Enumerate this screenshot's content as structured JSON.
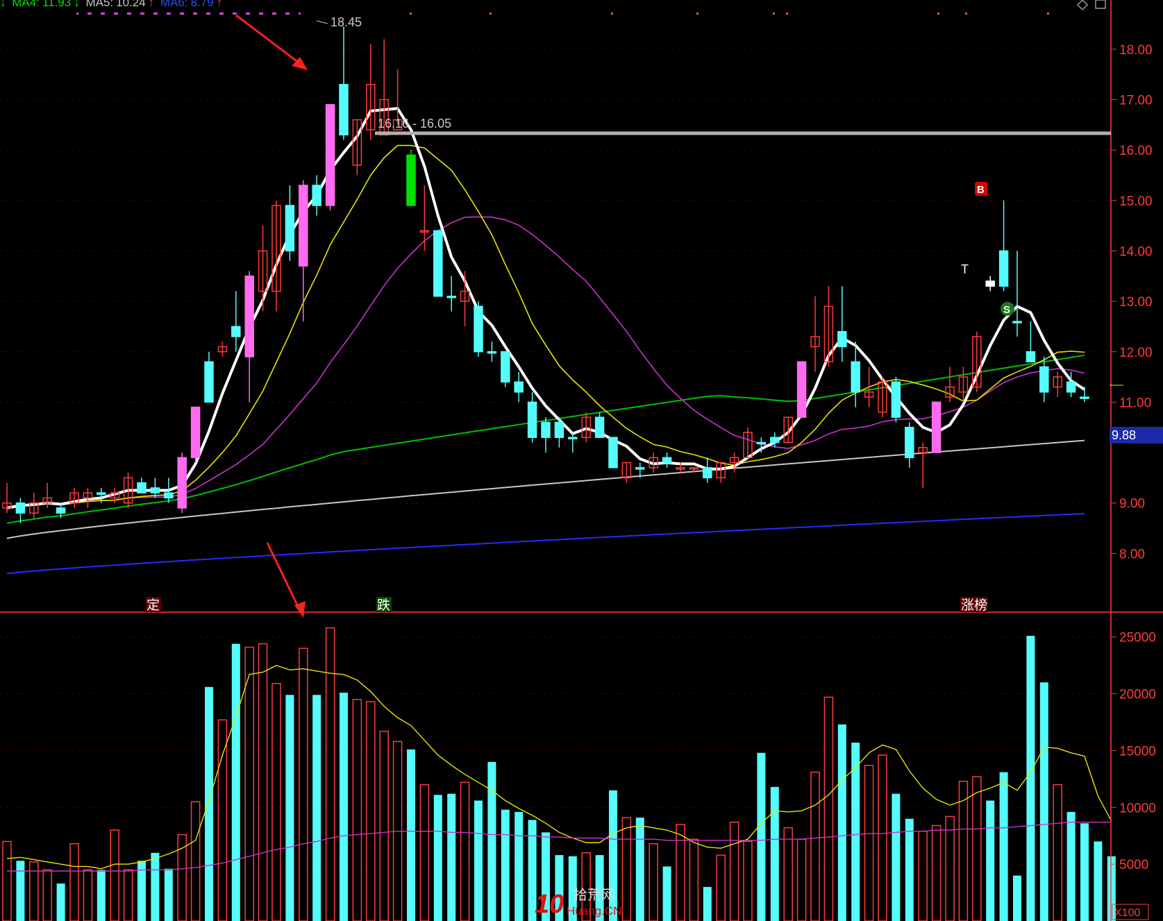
{
  "header": {
    "ma_items": [
      {
        "label": "MA4:",
        "value": "11.93",
        "arrow": "↓",
        "color": "#00e000"
      },
      {
        "label": "MA5:",
        "value": "10.24",
        "arrow": "↑",
        "color": "#c8c8c8"
      },
      {
        "label": "MA6:",
        "value": "8.79",
        "arrow": "↑",
        "color": "#2a4cff"
      }
    ]
  },
  "annotations": {
    "peak_label": "18.45",
    "level_label": "16.16 - 16.05",
    "current_price": "9.88",
    "signal_b": "B",
    "signal_s": "S",
    "signal_t": "T",
    "event_1": "定",
    "event_2": "跌",
    "event_3": "涨榜",
    "volume_unit": "X100",
    "watermark_cn": "拾荒网",
    "watermark_en": "Huang.CN",
    "watermark_num": "10"
  },
  "colors": {
    "up": "#ff3c3c",
    "down": "#54fcfc",
    "big_up": "#ff6bf0",
    "big_down": "#00e000",
    "ma1": "#ffffff",
    "ma2": "#e6e600",
    "ma3": "#cc33cc",
    "ma4": "#00c000",
    "ma5": "#c8c8c8",
    "ma6": "#2a2aff",
    "axis": "#ff3c3c"
  },
  "chart_data": [
    {
      "type": "candlestick",
      "y_ticks": [
        "18.00",
        "17.00",
        "16.00",
        "15.00",
        "14.00",
        "13.00",
        "12.00",
        "11.00",
        "9.00",
        "8.00"
      ],
      "ylim": [
        7.0,
        18.7
      ],
      "candles": [
        {
          "o": 9.0,
          "h": 9.4,
          "l": 8.8,
          "c": 8.9,
          "t": "up"
        },
        {
          "o": 8.8,
          "h": 9.1,
          "l": 8.6,
          "c": 9.0,
          "t": "down"
        },
        {
          "o": 8.8,
          "h": 9.2,
          "l": 8.7,
          "c": 9.0,
          "t": "up"
        },
        {
          "o": 9.0,
          "h": 9.4,
          "l": 8.9,
          "c": 9.1,
          "t": "up"
        },
        {
          "o": 8.9,
          "h": 9.0,
          "l": 8.7,
          "c": 8.8,
          "t": "down"
        },
        {
          "o": 9.0,
          "h": 9.3,
          "l": 8.9,
          "c": 9.2,
          "t": "up"
        },
        {
          "o": 9.1,
          "h": 9.3,
          "l": 8.9,
          "c": 9.2,
          "t": "up"
        },
        {
          "o": 9.2,
          "h": 9.3,
          "l": 9.0,
          "c": 9.2,
          "t": "down"
        },
        {
          "o": 9.2,
          "h": 9.3,
          "l": 9.0,
          "c": 9.1,
          "t": "up"
        },
        {
          "o": 9.0,
          "h": 9.6,
          "l": 8.9,
          "c": 9.5,
          "t": "up"
        },
        {
          "o": 9.4,
          "h": 9.5,
          "l": 9.2,
          "c": 9.2,
          "t": "down"
        },
        {
          "o": 9.3,
          "h": 9.5,
          "l": 9.1,
          "c": 9.2,
          "t": "down"
        },
        {
          "o": 9.2,
          "h": 9.5,
          "l": 9.0,
          "c": 9.1,
          "t": "down"
        },
        {
          "o": 8.9,
          "h": 10.0,
          "l": 8.8,
          "c": 9.9,
          "t": "bigup"
        },
        {
          "o": 9.9,
          "h": 10.9,
          "l": 9.8,
          "c": 10.9,
          "t": "bigup"
        },
        {
          "o": 11.0,
          "h": 12.0,
          "l": 11.0,
          "c": 11.8,
          "t": "down"
        },
        {
          "o": 12.0,
          "h": 12.2,
          "l": 11.9,
          "c": 12.1,
          "t": "up"
        },
        {
          "o": 12.3,
          "h": 13.2,
          "l": 12.0,
          "c": 12.5,
          "t": "down"
        },
        {
          "o": 11.9,
          "h": 13.6,
          "l": 11.0,
          "c": 13.5,
          "t": "bigup"
        },
        {
          "o": 13.2,
          "h": 14.5,
          "l": 12.8,
          "c": 14.0,
          "t": "up"
        },
        {
          "o": 13.2,
          "h": 15.0,
          "l": 12.8,
          "c": 14.9,
          "t": "up"
        },
        {
          "o": 14.0,
          "h": 15.3,
          "l": 13.8,
          "c": 14.9,
          "t": "down"
        },
        {
          "o": 13.7,
          "h": 15.4,
          "l": 12.6,
          "c": 15.3,
          "t": "bigup"
        },
        {
          "o": 14.9,
          "h": 15.5,
          "l": 14.7,
          "c": 15.3,
          "t": "down"
        },
        {
          "o": 14.9,
          "h": 16.9,
          "l": 14.8,
          "c": 16.9,
          "t": "bigup"
        },
        {
          "o": 17.3,
          "h": 18.45,
          "l": 16.2,
          "c": 16.3,
          "t": "down"
        },
        {
          "o": 15.7,
          "h": 16.6,
          "l": 15.5,
          "c": 16.6,
          "t": "up"
        },
        {
          "o": 16.4,
          "h": 18.1,
          "l": 16.2,
          "c": 17.3,
          "t": "up"
        },
        {
          "o": 16.3,
          "h": 18.2,
          "l": 16.3,
          "c": 17.0,
          "t": "up"
        },
        {
          "o": 16.6,
          "h": 17.6,
          "l": 16.5,
          "c": 16.4,
          "t": "up"
        },
        {
          "o": 15.9,
          "h": 16.0,
          "l": 14.9,
          "c": 14.9,
          "t": "bigdown"
        },
        {
          "o": 14.4,
          "h": 15.3,
          "l": 14.0,
          "c": 14.4,
          "t": "up"
        },
        {
          "o": 14.4,
          "h": 14.4,
          "l": 13.1,
          "c": 13.1,
          "t": "down"
        },
        {
          "o": 13.1,
          "h": 13.5,
          "l": 12.8,
          "c": 13.1,
          "t": "down"
        },
        {
          "o": 13.2,
          "h": 13.6,
          "l": 12.5,
          "c": 13.0,
          "t": "up"
        },
        {
          "o": 12.9,
          "h": 13.0,
          "l": 11.9,
          "c": 12.0,
          "t": "down"
        },
        {
          "o": 12.0,
          "h": 12.2,
          "l": 11.8,
          "c": 12.0,
          "t": "down"
        },
        {
          "o": 12.0,
          "h": 12.0,
          "l": 11.3,
          "c": 11.4,
          "t": "down"
        },
        {
          "o": 11.2,
          "h": 11.6,
          "l": 11.0,
          "c": 11.4,
          "t": "down"
        },
        {
          "o": 11.0,
          "h": 11.2,
          "l": 10.2,
          "c": 10.3,
          "t": "down"
        },
        {
          "o": 10.3,
          "h": 10.7,
          "l": 10.0,
          "c": 10.6,
          "t": "down"
        },
        {
          "o": 10.6,
          "h": 10.7,
          "l": 10.1,
          "c": 10.3,
          "t": "down"
        },
        {
          "o": 10.3,
          "h": 10.4,
          "l": 10.0,
          "c": 10.3,
          "t": "down"
        },
        {
          "o": 10.3,
          "h": 10.8,
          "l": 10.2,
          "c": 10.7,
          "t": "up"
        },
        {
          "o": 10.7,
          "h": 10.8,
          "l": 10.3,
          "c": 10.3,
          "t": "down"
        },
        {
          "o": 10.3,
          "h": 10.3,
          "l": 9.7,
          "c": 9.7,
          "t": "down"
        },
        {
          "o": 9.5,
          "h": 9.8,
          "l": 9.4,
          "c": 9.8,
          "t": "up"
        },
        {
          "o": 9.7,
          "h": 9.8,
          "l": 9.5,
          "c": 9.7,
          "t": "down"
        },
        {
          "o": 9.7,
          "h": 10.0,
          "l": 9.6,
          "c": 9.9,
          "t": "up"
        },
        {
          "o": 9.9,
          "h": 10.0,
          "l": 9.7,
          "c": 9.8,
          "t": "down"
        },
        {
          "o": 9.7,
          "h": 9.8,
          "l": 9.6,
          "c": 9.7,
          "t": "up"
        },
        {
          "o": 9.7,
          "h": 9.7,
          "l": 9.6,
          "c": 9.7,
          "t": "up"
        },
        {
          "o": 9.7,
          "h": 9.9,
          "l": 9.4,
          "c": 9.5,
          "t": "down"
        },
        {
          "o": 9.5,
          "h": 9.8,
          "l": 9.4,
          "c": 9.8,
          "t": "up"
        },
        {
          "o": 9.8,
          "h": 10.0,
          "l": 9.6,
          "c": 9.9,
          "t": "up"
        },
        {
          "o": 9.9,
          "h": 10.5,
          "l": 9.9,
          "c": 10.4,
          "t": "up"
        },
        {
          "o": 10.2,
          "h": 10.3,
          "l": 10.0,
          "c": 10.2,
          "t": "down"
        },
        {
          "o": 10.2,
          "h": 10.4,
          "l": 10.1,
          "c": 10.3,
          "t": "down"
        },
        {
          "o": 10.2,
          "h": 10.7,
          "l": 10.2,
          "c": 10.7,
          "t": "up"
        },
        {
          "o": 10.7,
          "h": 11.8,
          "l": 10.7,
          "c": 11.8,
          "t": "bigup"
        },
        {
          "o": 12.1,
          "h": 13.1,
          "l": 11.6,
          "c": 12.3,
          "t": "up"
        },
        {
          "o": 11.8,
          "h": 13.3,
          "l": 11.7,
          "c": 12.9,
          "t": "up"
        },
        {
          "o": 12.4,
          "h": 13.3,
          "l": 11.8,
          "c": 12.1,
          "t": "down"
        },
        {
          "o": 11.8,
          "h": 12.2,
          "l": 10.9,
          "c": 11.2,
          "t": "down"
        },
        {
          "o": 11.2,
          "h": 11.7,
          "l": 10.9,
          "c": 11.1,
          "t": "up"
        },
        {
          "o": 10.8,
          "h": 11.5,
          "l": 10.7,
          "c": 11.4,
          "t": "up"
        },
        {
          "o": 11.4,
          "h": 11.5,
          "l": 10.6,
          "c": 10.7,
          "t": "down"
        },
        {
          "o": 10.5,
          "h": 10.6,
          "l": 9.7,
          "c": 9.9,
          "t": "down"
        },
        {
          "o": 10.1,
          "h": 10.2,
          "l": 9.3,
          "c": 10.0,
          "t": "up"
        },
        {
          "o": 10.0,
          "h": 11.0,
          "l": 10.0,
          "c": 11.0,
          "t": "bigup"
        },
        {
          "o": 11.1,
          "h": 11.7,
          "l": 11.0,
          "c": 11.3,
          "t": "up"
        },
        {
          "o": 11.2,
          "h": 11.7,
          "l": 11.0,
          "c": 11.5,
          "t": "up"
        },
        {
          "o": 11.3,
          "h": 12.4,
          "l": 11.2,
          "c": 12.3,
          "t": "up"
        },
        {
          "o": 13.3,
          "h": 13.5,
          "l": 13.2,
          "c": 13.4,
          "t": "T"
        },
        {
          "o": 14.0,
          "h": 15.0,
          "l": 13.2,
          "c": 13.3,
          "t": "down"
        },
        {
          "o": 12.6,
          "h": 14.0,
          "l": 12.3,
          "c": 12.6,
          "t": "down"
        },
        {
          "o": 12.0,
          "h": 12.6,
          "l": 11.8,
          "c": 11.8,
          "t": "down"
        },
        {
          "o": 11.7,
          "h": 11.9,
          "l": 11.0,
          "c": 11.2,
          "t": "down"
        },
        {
          "o": 11.3,
          "h": 11.6,
          "l": 11.1,
          "c": 11.5,
          "t": "up"
        },
        {
          "o": 11.4,
          "h": 11.6,
          "l": 11.1,
          "c": 11.2,
          "t": "down"
        },
        {
          "o": 11.1,
          "h": 11.3,
          "l": 11.0,
          "c": 11.1,
          "t": "down"
        }
      ]
    },
    {
      "type": "bar",
      "y_ticks": [
        "25000",
        "20000",
        "15000",
        "10000",
        "5000"
      ],
      "ylim": [
        0,
        27000
      ],
      "values": [
        7000,
        5300,
        5200,
        4500,
        3300,
        6800,
        4500,
        4500,
        8000,
        4500,
        5300,
        6000,
        4600,
        7600,
        10500,
        20600,
        17700,
        24400,
        24100,
        24400,
        20900,
        19900,
        24000,
        19900,
        25800,
        20100,
        19500,
        19300,
        16700,
        15800,
        15100,
        12000,
        11100,
        11200,
        12200,
        10600,
        14000,
        9800,
        9600,
        8900,
        7800,
        5800,
        5700,
        6000,
        5800,
        11500,
        9100,
        9100,
        6800,
        4800,
        8500,
        7200,
        3000,
        5800,
        8700,
        7000,
        14800,
        11800,
        8200,
        7200,
        13100,
        19700,
        17300,
        15700,
        13700,
        14600,
        11200,
        9000,
        7900,
        8400,
        9200,
        12300,
        12700,
        10600,
        13100,
        4000,
        25100,
        21000,
        12000,
        9600,
        8600,
        7000,
        5700
      ],
      "series": [
        {
          "name": "MA1",
          "color": "#e6e600",
          "values": [
            5500,
            5600,
            5400,
            5200,
            5000,
            4800,
            4800,
            4600,
            5000,
            5000,
            5200,
            5500,
            5900,
            6400,
            7100,
            10600,
            14600,
            18000,
            21700,
            21900,
            22500,
            22100,
            22200,
            22000,
            21800,
            21700,
            21200,
            20200,
            18900,
            17900,
            17200,
            15900,
            14600,
            13700,
            12900,
            12200,
            11500,
            10600,
            9900,
            9300,
            8600,
            7800,
            7300,
            6900,
            6900,
            7700,
            8200,
            8400,
            8200,
            8000,
            7600,
            6900,
            6500,
            6400,
            6800,
            7200,
            8600,
            9700,
            9600,
            9700,
            10200,
            11100,
            12400,
            13500,
            14800,
            15500,
            15100,
            13200,
            11700,
            10700,
            10200,
            10600,
            11300,
            11700,
            12200,
            11500,
            13100,
            15300,
            15200,
            14800,
            14500,
            11000,
            8800
          ]
        },
        {
          "name": "MA2",
          "color": "#cc33cc",
          "values": [
            4400,
            4400,
            4400,
            4400,
            4400,
            4400,
            4400,
            4400,
            4400,
            4400,
            4500,
            4500,
            4500,
            4600,
            4700,
            4900,
            5100,
            5400,
            5700,
            6000,
            6300,
            6500,
            6800,
            7000,
            7300,
            7500,
            7600,
            7700,
            7800,
            7900,
            7900,
            7900,
            7900,
            7800,
            7800,
            7700,
            7600,
            7600,
            7500,
            7500,
            7400,
            7400,
            7300,
            7300,
            7300,
            7200,
            7200,
            7200,
            7200,
            7100,
            7100,
            7100,
            7100,
            7100,
            7100,
            7100,
            7100,
            7200,
            7200,
            7200,
            7300,
            7400,
            7500,
            7600,
            7700,
            7700,
            7800,
            7900,
            7900,
            8000,
            8000,
            8100,
            8100,
            8200,
            8200,
            8300,
            8400,
            8500,
            8600,
            8700,
            8700,
            8700,
            8700
          ]
        }
      ]
    }
  ]
}
